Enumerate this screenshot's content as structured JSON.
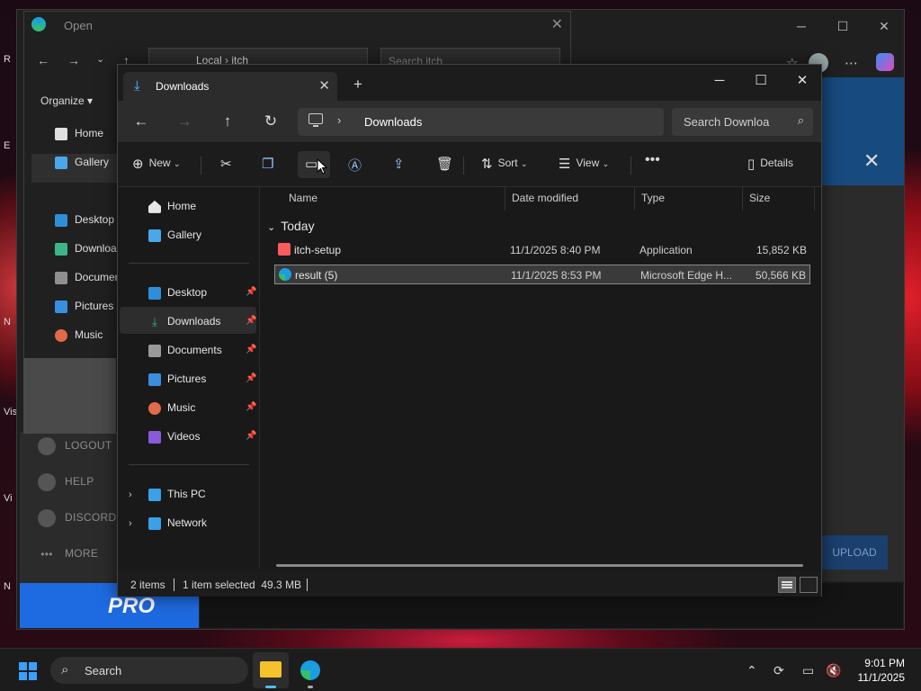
{
  "background_window": {
    "edge_left_letters": [
      "R",
      "E",
      "N",
      "Vis",
      "Vi",
      "N"
    ]
  },
  "itch_app": {
    "sidebar_items": [
      {
        "label": "LOGOUT",
        "icon": "logout-icon"
      },
      {
        "label": "HELP",
        "icon": "help-icon"
      },
      {
        "label": "DISCORD",
        "icon": "discord-icon"
      },
      {
        "label": "MORE",
        "icon": "more-icon"
      }
    ],
    "pro_label": "PRO",
    "upload_label": "UPLOAD"
  },
  "open_dialog": {
    "title": "Open",
    "address": "Local  ›  itch",
    "search_placeholder": "Search itch",
    "organize_label": "Organize",
    "side_items": [
      {
        "label": "Home",
        "color": "#e0e0e0"
      },
      {
        "label": "Gallery",
        "color": "#4aa8e8"
      },
      {
        "label": "Desktop",
        "color": "#2e8fd8"
      },
      {
        "label": "Downloa",
        "color": "#3db58a"
      },
      {
        "label": "Documen",
        "color": "#8f8f8f"
      },
      {
        "label": "Pictures",
        "color": "#3a8ee0"
      },
      {
        "label": "Music",
        "color": "#e06a4a"
      }
    ]
  },
  "explorer": {
    "tab_label": "Downloads",
    "address_label": "Downloads",
    "search_placeholder": "Search Downloa",
    "toolbar": {
      "new_label": "New",
      "sort_label": "Sort",
      "view_label": "View",
      "details_label": "Details"
    },
    "sidebar": {
      "quick": [
        {
          "label": "Home",
          "icon": "home-icon",
          "color": "#e8e8e8"
        },
        {
          "label": "Gallery",
          "icon": "gallery-icon",
          "color": "#4aa8e8"
        }
      ],
      "pinned": [
        {
          "label": "Desktop",
          "icon": "desktop-icon",
          "color": "#2e8fd8"
        },
        {
          "label": "Downloads",
          "icon": "downloads-icon",
          "color": "#3db58a"
        },
        {
          "label": "Documents",
          "icon": "documents-icon",
          "color": "#9a9a9a"
        },
        {
          "label": "Pictures",
          "icon": "pictures-icon",
          "color": "#3a8ee0"
        },
        {
          "label": "Music",
          "icon": "music-icon",
          "color": "#e06a4a"
        },
        {
          "label": "Videos",
          "icon": "videos-icon",
          "color": "#8a5ad8"
        }
      ],
      "devices": [
        {
          "label": "This PC",
          "icon": "this-pc-icon",
          "color": "#3aa0e8"
        },
        {
          "label": "Network",
          "icon": "network-icon",
          "color": "#3aa0e8"
        }
      ]
    },
    "columns": [
      "Name",
      "Date modified",
      "Type",
      "Size"
    ],
    "group_label": "Today",
    "files": [
      {
        "name": "itch-setup",
        "date": "11/1/2025 8:40 PM",
        "type": "Application",
        "size": "15,852 KB",
        "icon": "itch-app-icon",
        "color": "#fa5c5c"
      },
      {
        "name": "result (5)",
        "date": "11/1/2025 8:53 PM",
        "type": "Microsoft Edge H...",
        "size": "50,566 KB",
        "icon": "edge-html-icon",
        "color": "#1b9de2"
      }
    ],
    "status": {
      "count": "2 items",
      "selected": "1 item selected  49.3 MB"
    }
  },
  "taskbar": {
    "search_label": "Search",
    "time": "9:01 PM",
    "date": "11/1/2025"
  }
}
